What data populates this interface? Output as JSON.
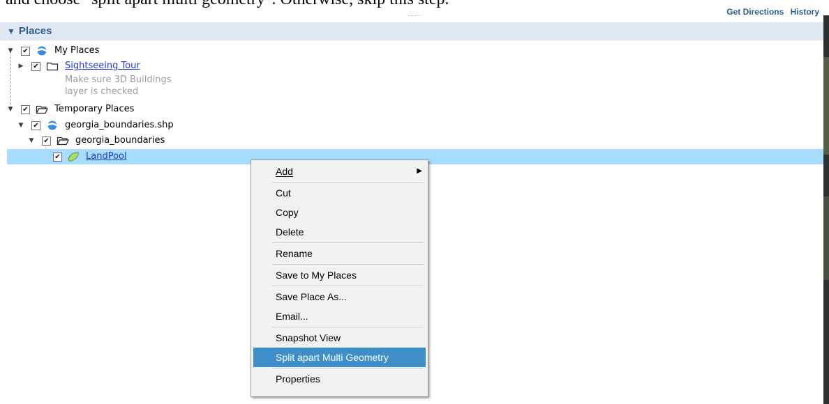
{
  "doc_text": "and choose \"split apart multi geometry\". Otherwise, skip this step.",
  "top_links": [
    "Get Directions",
    "History"
  ],
  "panel": {
    "title": "Places"
  },
  "tree": {
    "my_places": "My Places",
    "sightseeing_tour": "Sightseeing Tour",
    "sightseeing_desc": [
      "Make sure 3D Buildings",
      "layer is checked"
    ],
    "temporary_places": "Temporary Places",
    "shp_file": "georgia_boundaries.shp",
    "boundaries_folder": "georgia_boundaries",
    "landpool": "LandPool"
  },
  "context_menu": {
    "items": [
      {
        "label": "Add",
        "has_submenu": true
      },
      {
        "label": "Cut"
      },
      {
        "label": "Copy"
      },
      {
        "label": "Delete"
      },
      {
        "label": "Rename"
      },
      {
        "label": "Save to My Places"
      },
      {
        "label": "Save Place As..."
      },
      {
        "label": "Email..."
      },
      {
        "label": "Snapshot View"
      },
      {
        "label": "Split apart Multi Geometry",
        "highlighted": true
      },
      {
        "label": "Properties"
      }
    ]
  },
  "colors": {
    "selection": "#a8dcff",
    "menu_highlight": "#3d8ec9",
    "header_text": "#2f5d8d",
    "link": "#1f39d8"
  }
}
